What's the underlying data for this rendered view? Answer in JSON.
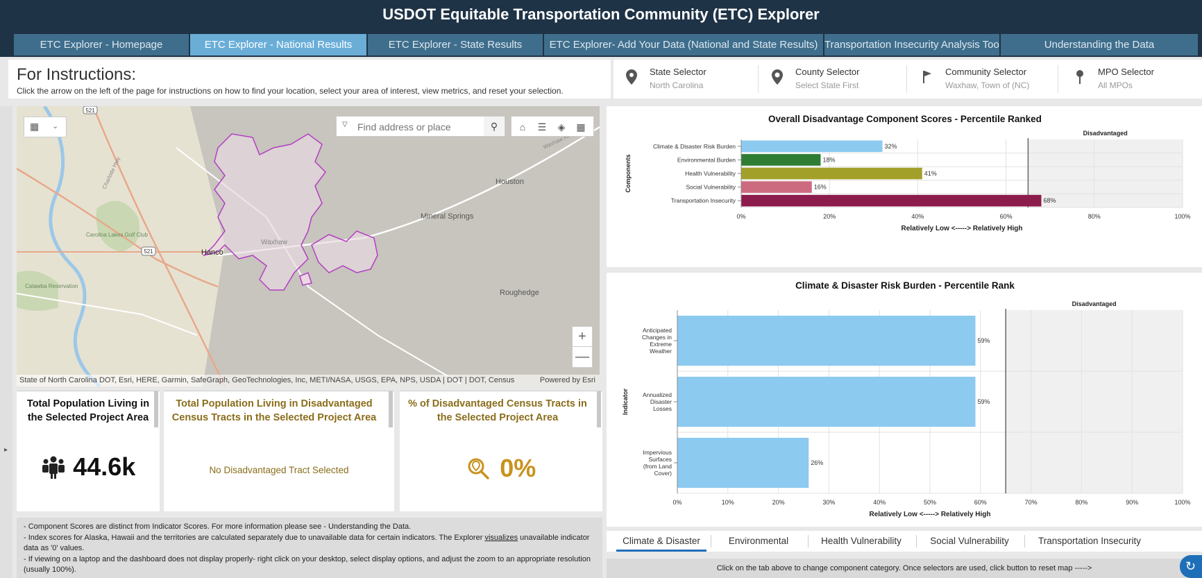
{
  "app_title": "USDOT Equitable Transportation Community (ETC) Explorer",
  "tabs": [
    {
      "label": "ETC Explorer - Homepage"
    },
    {
      "label": "ETC Explorer - National Results"
    },
    {
      "label": "ETC Explorer - State Results"
    },
    {
      "label": "ETC Explorer- Add Your Data (National and State Results)"
    },
    {
      "label": "Transportation Insecurity Analysis Tool"
    },
    {
      "label": "Understanding the Data"
    }
  ],
  "instructions": {
    "title": "For Instructions:",
    "text": "Click the arrow on the left of the page for instructions on how to find your location, select your area of interest, view metrics, and reset your selection."
  },
  "selectors": [
    {
      "label": "State Selector",
      "value": "North Carolina",
      "icon": "map-pin-icon"
    },
    {
      "label": "County Selector",
      "value": "Select State First",
      "icon": "location-pin-icon"
    },
    {
      "label": "Community Selector",
      "value": "Waxhaw, Town of (NC)",
      "icon": "flag-icon"
    },
    {
      "label": "MPO Selector",
      "value": "All MPOs",
      "icon": "push-pin-icon"
    }
  ],
  "map": {
    "search_placeholder": "Find address or place",
    "labels": {
      "houston": "Houston",
      "mineral_springs": "Mineral Springs",
      "hancock": "Hanco",
      "waxhaw": "Waxhaw",
      "roughedge": "Roughedge",
      "carolina_lakes": "Carolina Lakes Golf Club",
      "catawba": "Catawba Reservation",
      "route_521_a": "521",
      "route_521_b": "521",
      "charlotte_hwy": "Charlotte Hwy",
      "waxhaw_hwy": "Waxhaw Hwy"
    },
    "attribution": "State of North Carolina DOT, Esri, HERE, Garmin, SafeGraph, GeoTechnologies, Inc, METI/NASA, USGS, EPA, NPS, USDA | DOT | DOT, Census",
    "powered_by": "Powered by Esri",
    "zoom_in": "+",
    "zoom_out": "—"
  },
  "cards": {
    "population": {
      "title": "Total Population Living in the Selected Project Area",
      "value": "44.6k",
      "icon": "people-icon"
    },
    "disadvantaged": {
      "title": "Total Population Living in Disadvantaged Census Tracts in the Selected Project Area",
      "value": "No Disadvantaged Tract Selected"
    },
    "percent": {
      "title": "% of Disadvantaged Census Tracts in the Selected Project Area",
      "value": "0%",
      "icon": "search-location-icon"
    }
  },
  "notes": {
    "line1": "- Component Scores are distinct from Indicator Scores. For more information please see - Understanding the Data.",
    "line2a": "- Index scores for Alaska, Hawaii and the territories are calculated separately due to unavailable data for certain indicators. The Explorer ",
    "line2_link": "visualizes",
    "line2b": " unavailable indicator data as '0' values.",
    "line3": "- If viewing on a laptop and the dashboard does not display properly- right click on your desktop, select display options, and adjust the zoom to an appropriate resolution (usually 100%)."
  },
  "chart_data": [
    {
      "type": "bar",
      "orientation": "horizontal",
      "title": "Overall Disadvantage Component Scores - Percentile Ranked",
      "xlabel": "Relatively Low <-----> Relatively High",
      "ylabel": "Components",
      "xlim": [
        0,
        100
      ],
      "x_ticks": [
        "0%",
        "20%",
        "40%",
        "60%",
        "80%",
        "100%"
      ],
      "threshold": 65,
      "threshold_label": "Disadvantaged",
      "categories": [
        "Climate & Disaster Risk Burden",
        "Environmental Burden",
        "Health Vulnerability",
        "Social Vulnerability",
        "Transportation Insecurity"
      ],
      "values": [
        32,
        18,
        41,
        16,
        68
      ],
      "value_labels": [
        "32%",
        "18%",
        "41%",
        "16%",
        "68%"
      ],
      "colors": [
        "#8ccaf0",
        "#2e7d32",
        "#a3a02a",
        "#cc6b80",
        "#8c1c4c"
      ]
    },
    {
      "type": "bar",
      "orientation": "horizontal",
      "title": "Climate & Disaster Risk Burden - Percentile Rank",
      "xlabel": "Relatively Low <-----> Relatively High",
      "ylabel": "Indicator",
      "xlim": [
        0,
        100
      ],
      "x_ticks": [
        "0%",
        "10%",
        "20%",
        "30%",
        "40%",
        "50%",
        "60%",
        "70%",
        "80%",
        "90%",
        "100%"
      ],
      "threshold": 65,
      "threshold_label": "Disadvantaged",
      "categories": [
        [
          "Anticipated",
          "Changes in",
          "Extreme",
          "Weather"
        ],
        [
          "Annualized",
          "Disaster",
          "Losses"
        ],
        [
          "Impervious",
          "Surfaces",
          "(from Land",
          "Cover)"
        ]
      ],
      "values": [
        59,
        59,
        26
      ],
      "value_labels": [
        "59%",
        "59%",
        "26%"
      ],
      "colors": [
        "#8ccaf0",
        "#8ccaf0",
        "#8ccaf0"
      ]
    }
  ],
  "component_tabs": [
    "Climate & Disaster",
    "Environmental",
    "Health Vulnerability",
    "Social Vulnerability",
    "Transportation Insecurity"
  ],
  "footer_text": "Click on the tab above to change component category. Once selectors are used, click button to reset map ----->"
}
